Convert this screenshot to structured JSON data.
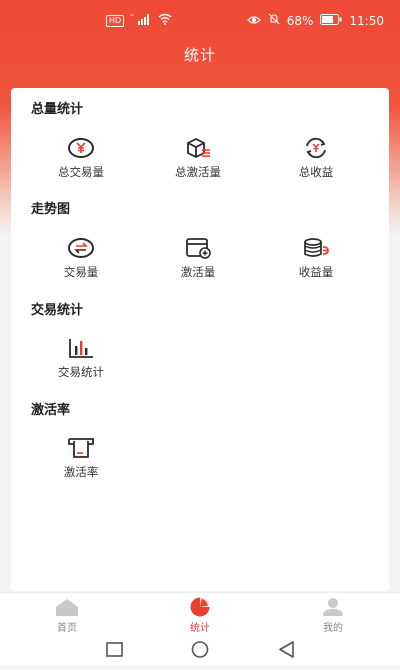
{
  "status": {
    "hd": "HD",
    "signal": "⁴⁶",
    "battery": "68%",
    "time": "11:50"
  },
  "header": {
    "title": "统计"
  },
  "sections": {
    "total": {
      "title": "总量统计",
      "items": [
        {
          "label": "总交易量",
          "icon": "yuan-coin-icon"
        },
        {
          "label": "总激活量",
          "icon": "box-activation-icon"
        },
        {
          "label": "总收益",
          "icon": "refresh-coin-icon"
        }
      ]
    },
    "trend": {
      "title": "走势图",
      "items": [
        {
          "label": "交易量",
          "icon": "exchange-coin-icon"
        },
        {
          "label": "激活量",
          "icon": "card-add-icon"
        },
        {
          "label": "收益量",
          "icon": "coin-stack-icon"
        }
      ]
    },
    "trade": {
      "title": "交易统计",
      "items": [
        {
          "label": "交易统计",
          "icon": "bar-chart-icon"
        }
      ]
    },
    "activation": {
      "title": "激活率",
      "items": [
        {
          "label": "激活率",
          "icon": "pos-machine-icon"
        }
      ]
    }
  },
  "tabs": [
    {
      "label": "首页",
      "icon": "home-icon",
      "active": false
    },
    {
      "label": "统计",
      "icon": "pie-chart-icon",
      "active": true
    },
    {
      "label": "我的",
      "icon": "user-icon",
      "active": false
    }
  ],
  "colors": {
    "accent": "#e8402f",
    "icon_dark": "#2b2b2b",
    "icon_accent": "#e8402f"
  }
}
